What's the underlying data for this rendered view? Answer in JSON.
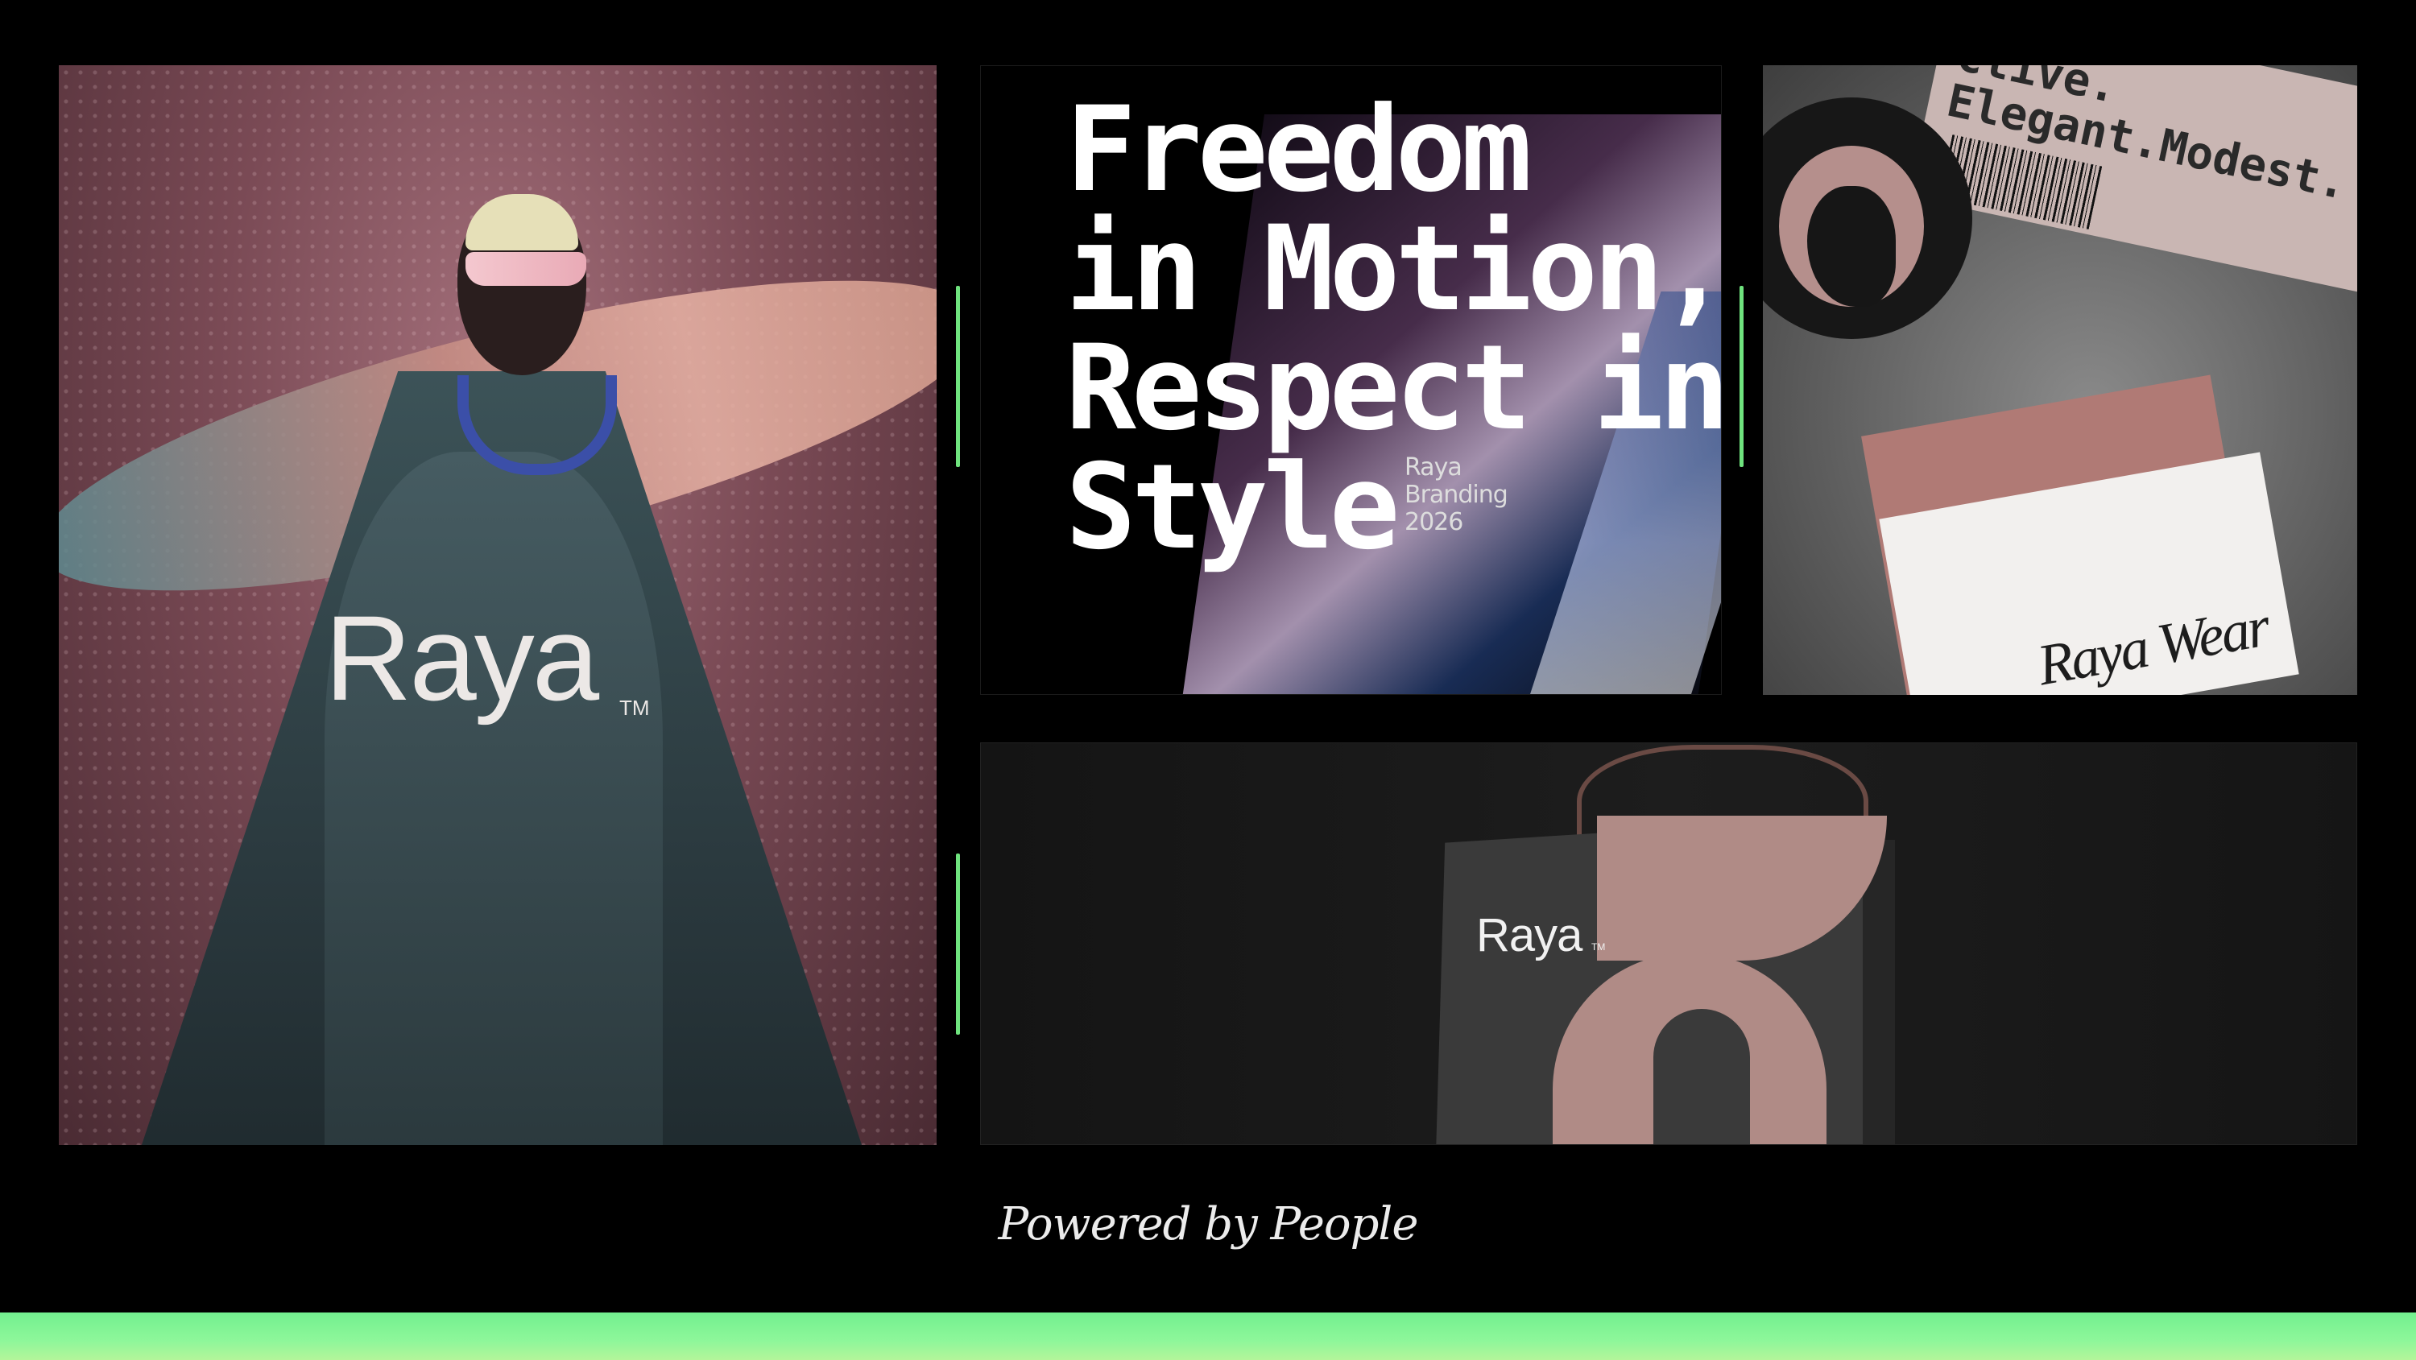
{
  "left_panel": {
    "logo": "Raya",
    "trademark": "TM"
  },
  "poster": {
    "headline": [
      "Freedom",
      "in Motion,",
      "Respect in",
      "Style"
    ],
    "caption": [
      "Raya",
      "Branding",
      "2026"
    ]
  },
  "stationery": {
    "torn_label": [
      "ctive.",
      "Elegant.Modest."
    ],
    "script_logo": "Raya Wear"
  },
  "bag": {
    "logo": "Raya",
    "trademark": "TM"
  },
  "footer": {
    "tagline": "Powered by People"
  },
  "colors": {
    "background": "#000000",
    "accent_green": "#6fe37e",
    "brand_rose": "#b08b86"
  }
}
